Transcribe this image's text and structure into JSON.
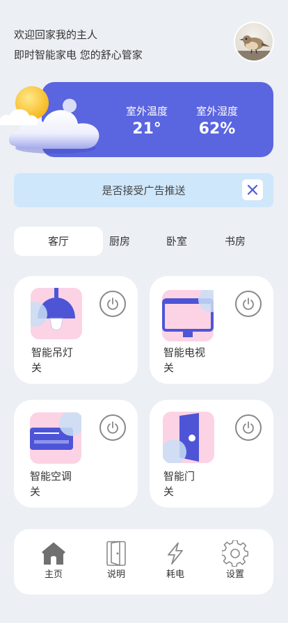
{
  "greeting": {
    "line1": "欢迎回家我的主人",
    "line2": "即时智能家电  您的舒心管家"
  },
  "weather": {
    "outdoor_temp_label": "室外温度",
    "outdoor_temp_value": "21°",
    "humidity_label": "室外湿度",
    "humidity_value": "62%"
  },
  "ad": {
    "text": "是否接受广告推送"
  },
  "tabs": [
    {
      "label": "客厅",
      "active": true
    },
    {
      "label": "厨房",
      "active": false
    },
    {
      "label": "卧室",
      "active": false
    },
    {
      "label": "书房",
      "active": false
    }
  ],
  "devices": [
    {
      "name": "智能吊灯",
      "state": "关",
      "icon": "pendant-lamp-icon"
    },
    {
      "name": "智能电视",
      "state": "关",
      "icon": "tv-icon"
    },
    {
      "name": "智能空调",
      "state": "关",
      "icon": "air-conditioner-icon"
    },
    {
      "name": "智能门",
      "state": "关",
      "icon": "door-icon"
    }
  ],
  "nav": [
    {
      "label": "主页",
      "icon": "home-icon"
    },
    {
      "label": "说明",
      "icon": "door-manual-icon"
    },
    {
      "label": "耗电",
      "icon": "lightning-icon"
    },
    {
      "label": "设置",
      "icon": "gear-icon"
    }
  ],
  "colors": {
    "accent": "#5a65e0",
    "background": "#eceff4",
    "ad_background": "#cfe7fb",
    "icon_pink": "#fcd3e4"
  }
}
